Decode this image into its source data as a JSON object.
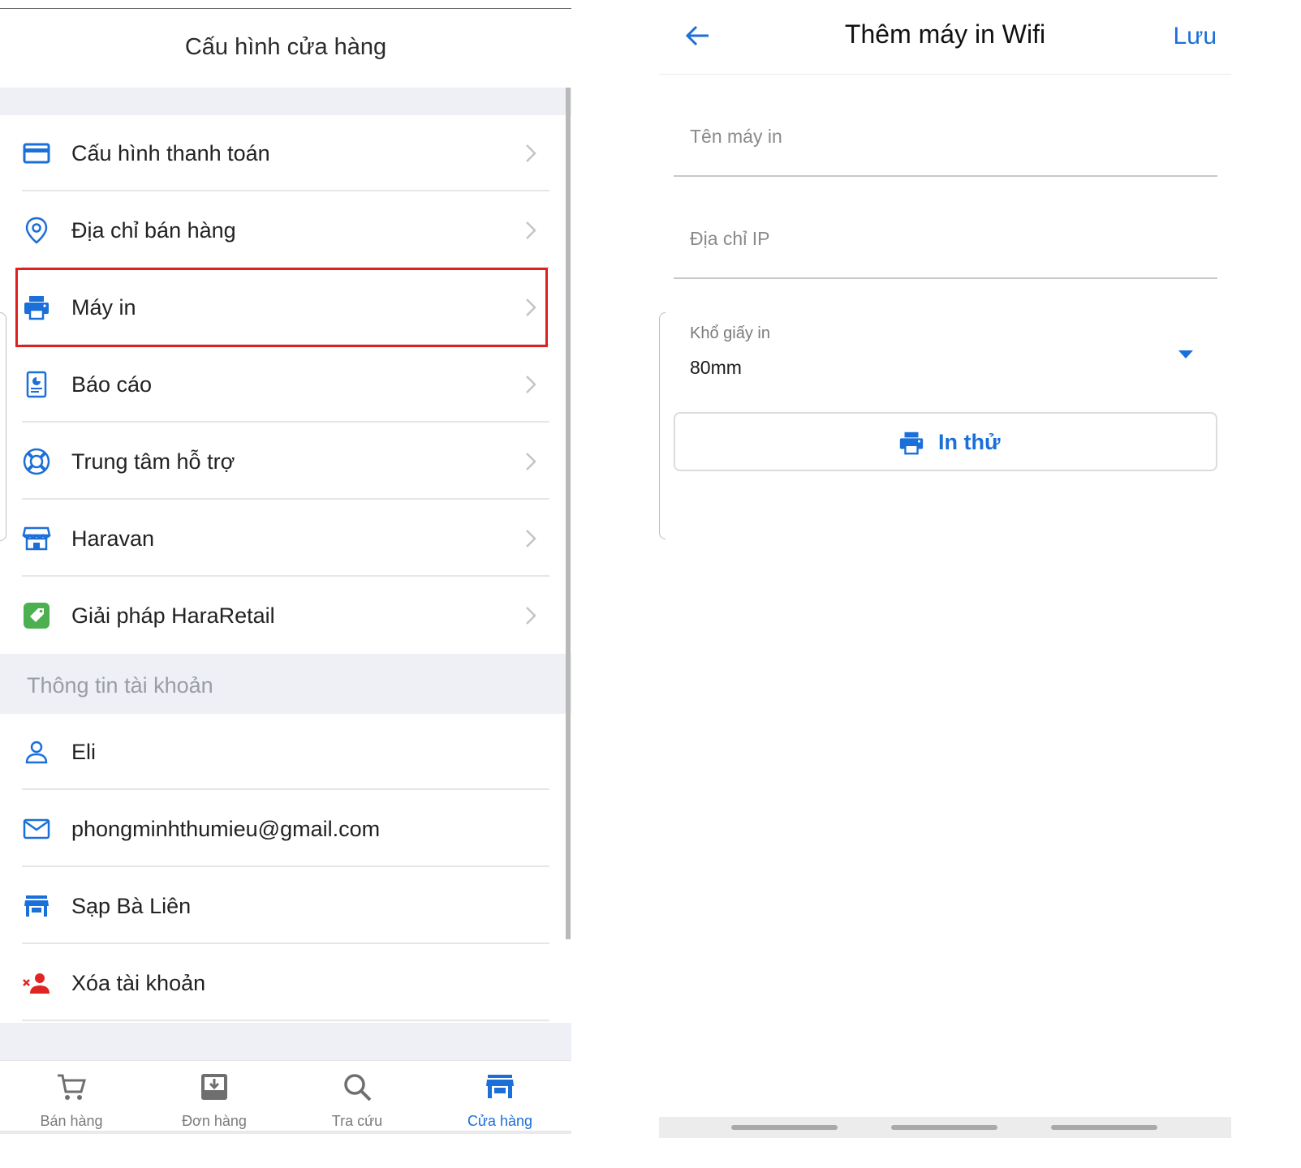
{
  "left": {
    "title": "Cấu hình cửa hàng",
    "store_items": [
      {
        "label": "Cấu hình thanh toán",
        "icon": "credit-card-icon"
      },
      {
        "label": "Địa chỉ bán hàng",
        "icon": "location-pin-icon"
      },
      {
        "label": "Máy in",
        "icon": "printer-icon"
      },
      {
        "label": "Báo cáo",
        "icon": "report-icon"
      },
      {
        "label": "Trung tâm hỗ trợ",
        "icon": "lifebuoy-icon"
      },
      {
        "label": "Haravan",
        "icon": "storefront-icon"
      },
      {
        "label": "Giải pháp HaraRetail",
        "icon": "tag-icon"
      }
    ],
    "account_section": "Thông tin tài khoản",
    "account_items": [
      {
        "label": "Eli",
        "icon": "user-icon"
      },
      {
        "label": "phongminhthumieu@gmail.com",
        "icon": "mail-icon"
      },
      {
        "label": "Sạp Bà Liên",
        "icon": "store-icon"
      },
      {
        "label": "Xóa tài khoản",
        "icon": "remove-user-icon"
      }
    ],
    "tabs": [
      {
        "label": "Bán hàng",
        "icon": "cart-icon"
      },
      {
        "label": "Đơn hàng",
        "icon": "inbox-icon"
      },
      {
        "label": "Tra cứu",
        "icon": "search-icon"
      },
      {
        "label": "Cửa hàng",
        "icon": "store-icon",
        "active": true
      }
    ]
  },
  "right": {
    "title": "Thêm máy in Wifi",
    "save_label": "Lưu",
    "printer_name_placeholder": "Tên máy in",
    "ip_placeholder": "Địa chỉ IP",
    "paper_size_label": "Khổ giấy in",
    "paper_size_value": "80mm",
    "test_print_label": "In thử"
  },
  "colors": {
    "accent": "#1b6fd8",
    "highlight": "#e01f1f",
    "section_bg": "#eef0f6",
    "danger": "#e02424",
    "success": "#4caf50"
  }
}
